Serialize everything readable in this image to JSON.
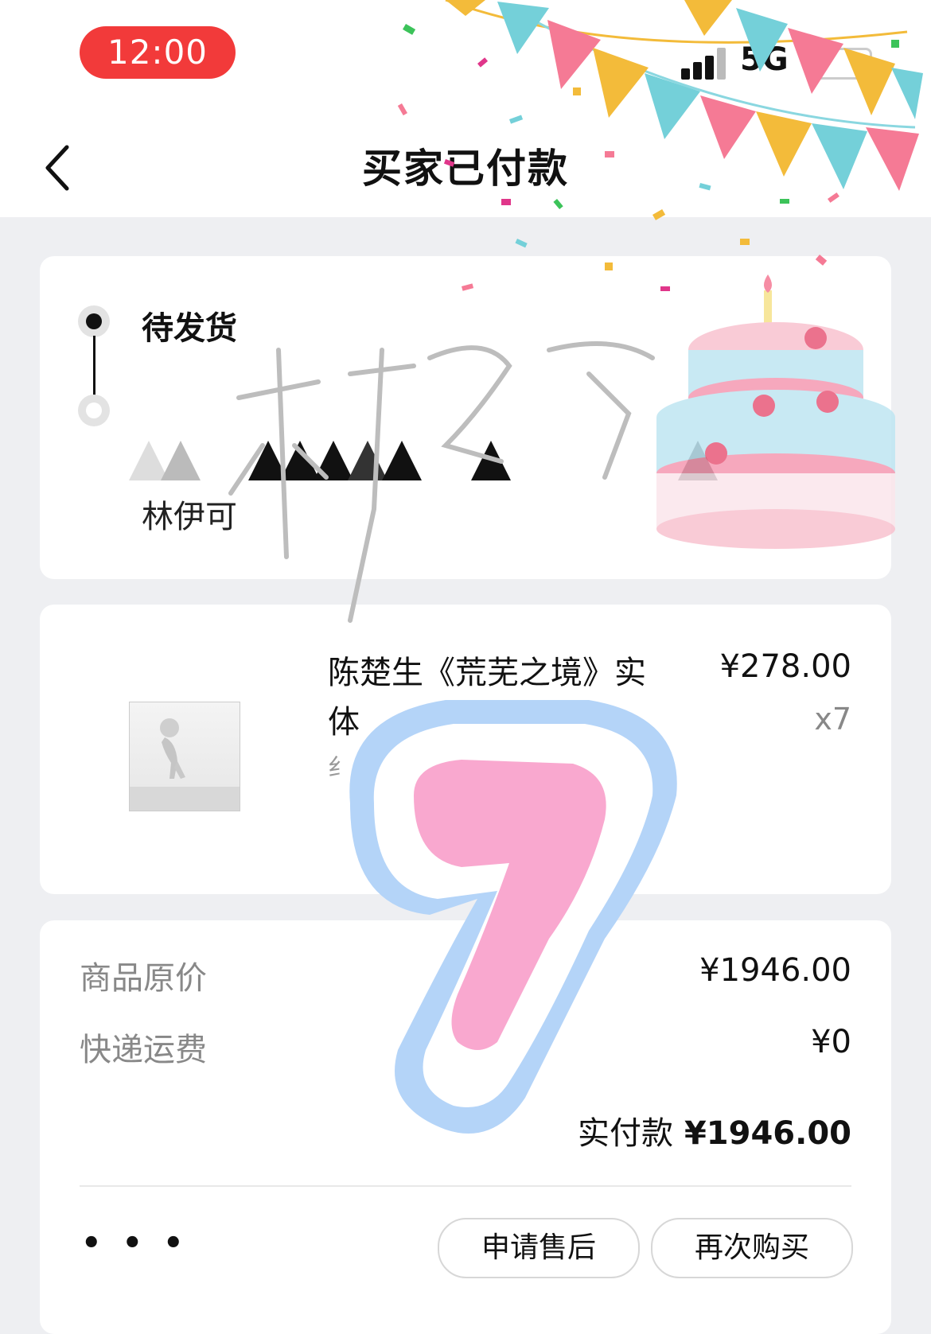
{
  "status_bar": {
    "time": "12:00",
    "network": "5G"
  },
  "header": {
    "title": "买家已付款",
    "back_icon": "chevron-left-icon"
  },
  "order_status": {
    "active_step": "待发货",
    "recipient_name": "林伊可"
  },
  "product": {
    "title": "陈楚生《荒芜之境》实体",
    "spec": "纟",
    "price": "¥278.00",
    "quantity": "x7"
  },
  "price_summary": {
    "original_price_label": "商品原价",
    "original_price_value": "¥1946.00",
    "shipping_label": "快递运费",
    "shipping_value": "¥0",
    "paid_label": "实付款",
    "paid_value": "¥1946.00"
  },
  "actions": {
    "more_label": "• • •",
    "after_sale_label": "申请售后",
    "buy_again_label": "再次购买"
  },
  "decorations": {
    "signature_text": "林伊可可",
    "sticker_number": "7",
    "colors": {
      "time_pill": "#f23a3a",
      "sticker_outline": "#b4d4f8",
      "sticker_fill": "#f9a8cf",
      "bunting_teal": "#74d0d9",
      "bunting_pink": "#f57a95",
      "bunting_gold": "#f3bb3a"
    }
  }
}
